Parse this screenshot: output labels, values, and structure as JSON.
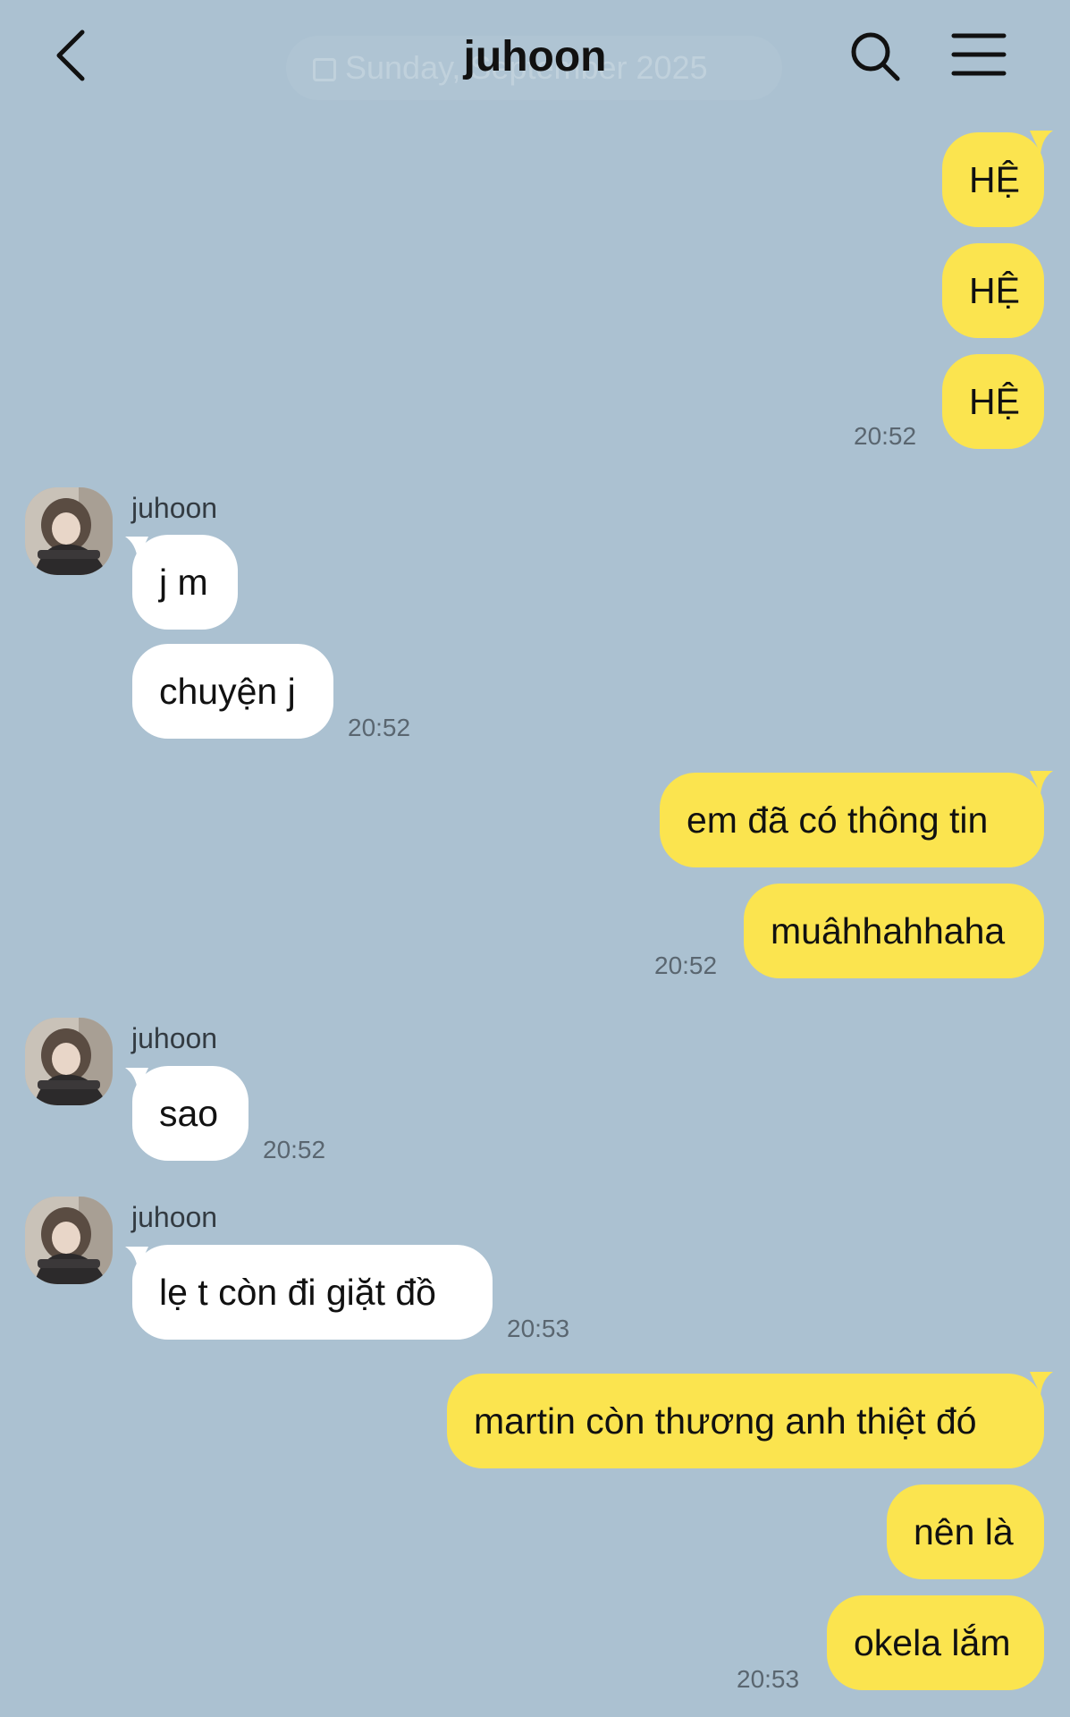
{
  "header": {
    "title": "juhoon",
    "date_pill": "Sunday, September 2025"
  },
  "messages": {
    "m1": "HỆ",
    "m2": "HỆ",
    "m3": "HỆ",
    "t1": "20:52",
    "sender1": "juhoon",
    "m4": "j m",
    "m5": "chuyện j",
    "t2": "20:52",
    "m6": "em đã có thông tin",
    "m7": "muâhhahhaha",
    "t3": "20:52",
    "sender2": "juhoon",
    "m8": "sao",
    "t4": "20:52",
    "sender3": "juhoon",
    "m9": "lẹ t còn đi giặt đồ",
    "t5": "20:53",
    "m10": "martin còn thương anh thiệt đó",
    "m11": "nên là",
    "m12": "okela lắm",
    "t6": "20:53"
  },
  "colors": {
    "background": "#abc1d1",
    "my_bubble": "#fbe44f",
    "their_bubble": "#ffffff"
  },
  "icons": {
    "back": "chevron-left-icon",
    "search": "search-icon",
    "menu": "hamburger-menu-icon",
    "date": "calendar-icon"
  }
}
